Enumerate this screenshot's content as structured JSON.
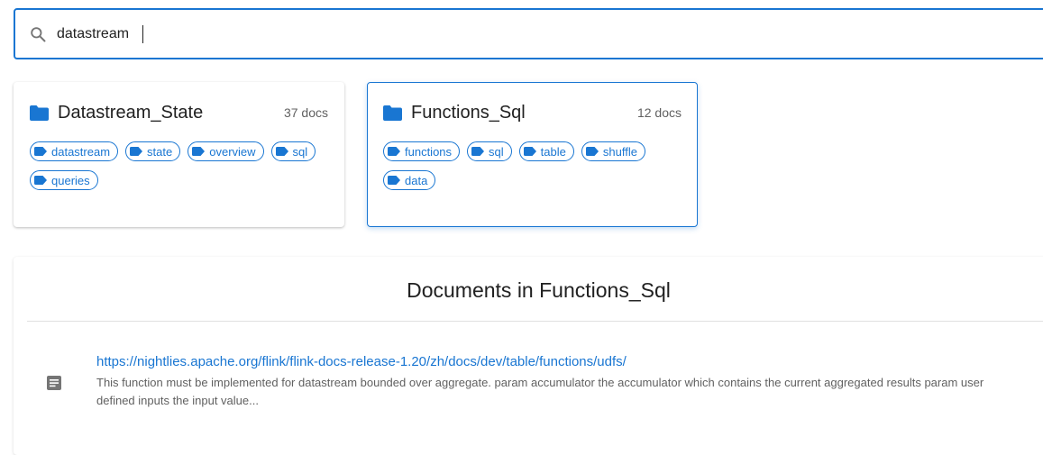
{
  "search": {
    "value": "datastream",
    "icon": "search-icon"
  },
  "collections": [
    {
      "title": "Datastream_State",
      "count": "37 docs",
      "tags": [
        "datastream",
        "state",
        "overview",
        "sql",
        "queries"
      ],
      "selected": false
    },
    {
      "title": "Functions_Sql",
      "count": "12 docs",
      "tags": [
        "functions",
        "sql",
        "table",
        "shuffle",
        "data"
      ],
      "selected": true
    }
  ],
  "documents": {
    "heading": "Documents in Functions_Sql",
    "items": [
      {
        "url": "https://nightlies.apache.org/flink/flink-docs-release-1.20/zh/docs/dev/table/functions/udfs/",
        "snippet": "This function must be implemented for datastream bounded over aggregate. param accumulator the accumulator which contains the current aggregated results param user defined inputs the input value..."
      }
    ]
  },
  "colors": {
    "accent": "#1976d2",
    "text": "#212121",
    "muted": "#616161",
    "doc_icon": "#757575"
  }
}
